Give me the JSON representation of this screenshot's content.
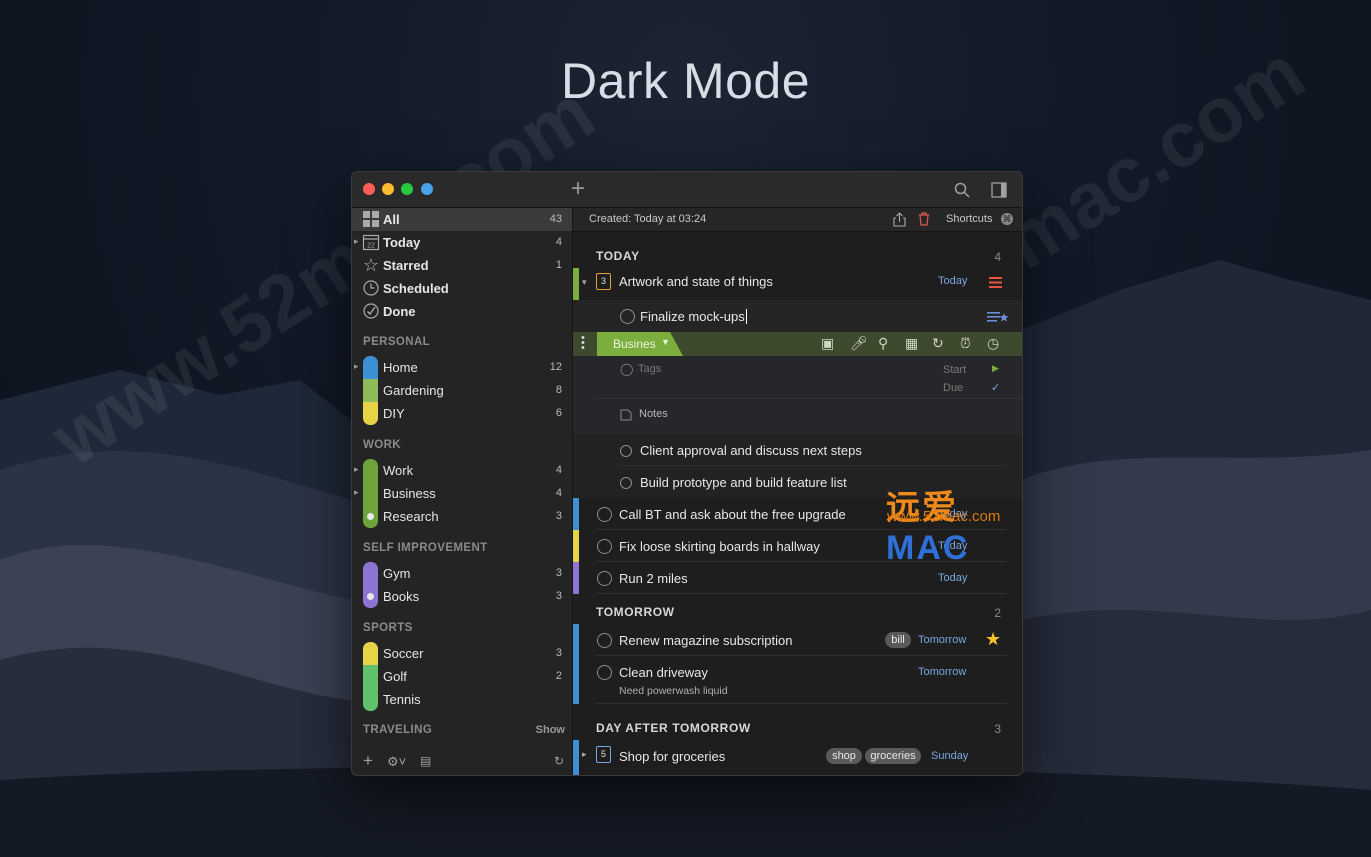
{
  "page": {
    "headline": "Dark Mode"
  },
  "watermarks": [
    "www.52mac.com",
    "www.52mac.com"
  ],
  "overlay_logo": {
    "cn_text": "远爱",
    "mac_text": "MAC",
    "url": "www.52mac.com"
  },
  "colors": {
    "close": "#ff5f57",
    "minimize": "#febc2e",
    "zoom": "#28c840",
    "extra": "#4aa3e8",
    "green_strip": "#7bae3c",
    "blue_strip": "#3f8fd6",
    "yellow_strip": "#e6d348",
    "purple_strip": "#8d74d4"
  },
  "toolbar": {
    "add_icon": "plus-icon",
    "search_icon": "search-icon",
    "sidebar_toggle_icon": "sidebar-toggle-icon"
  },
  "sidebar": {
    "smart_lists": [
      {
        "label": "All",
        "count": "43",
        "icon": "grid-icon"
      },
      {
        "label": "Today",
        "count": "4",
        "icon": "calendar-icon"
      },
      {
        "label": "Starred",
        "count": "1",
        "icon": "star-icon"
      },
      {
        "label": "Scheduled",
        "count": "",
        "icon": "clock-icon"
      },
      {
        "label": "Done",
        "count": "",
        "icon": "check-circle-icon"
      }
    ],
    "personal": {
      "title": "PERSONAL",
      "items": [
        {
          "label": "Home",
          "count": "12",
          "color": "#3f8fd6"
        },
        {
          "label": "Gardening",
          "count": "8",
          "color": "#8fba58"
        },
        {
          "label": "DIY",
          "count": "6",
          "color": "#e6d348"
        }
      ]
    },
    "work": {
      "title": "WORK",
      "items": [
        {
          "label": "Work",
          "count": "4",
          "color": "#6ea23a"
        },
        {
          "label": "Business",
          "count": "4",
          "color": "#6ea23a"
        },
        {
          "label": "Research",
          "count": "3",
          "color": "#6ea23a"
        }
      ]
    },
    "self_improvement": {
      "title": "SELF IMPROVEMENT",
      "items": [
        {
          "label": "Gym",
          "count": "3",
          "color": "#8d74d4"
        },
        {
          "label": "Books",
          "count": "3",
          "color": "#8d74d4"
        }
      ]
    },
    "sports": {
      "title": "SPORTS",
      "items": [
        {
          "label": "Soccer",
          "count": "3",
          "color": "#e6d348"
        },
        {
          "label": "Golf",
          "count": "2",
          "color": "#5fc26a"
        },
        {
          "label": "Tennis",
          "count": "",
          "color": "#5fc26a"
        }
      ]
    },
    "traveling": {
      "title": "TRAVELING",
      "action": "Show"
    }
  },
  "infobar": {
    "created": "Created: Today at 03:24",
    "shortcuts": "Shortcuts"
  },
  "groups": {
    "today": {
      "title": "TODAY",
      "count": "4"
    },
    "tomorrow": {
      "title": "TOMORROW",
      "count": "2"
    },
    "day_after": {
      "title": "DAY AFTER TOMORROW",
      "count": "3"
    }
  },
  "tasks": {
    "artwork": {
      "title": "Artwork and state of things",
      "date": "Today",
      "badge": "3"
    },
    "finalize": {
      "title": "Finalize mock-ups"
    },
    "editor": {
      "list": "Busines",
      "tags": "Tags",
      "start": "Start",
      "due": "Due",
      "notes": "Notes"
    },
    "client": {
      "title": "Client approval and discuss next steps"
    },
    "build": {
      "title": "Build prototype and build feature list"
    },
    "call": {
      "title": "Call BT and ask about the free upgrade",
      "date": "Today"
    },
    "fix": {
      "title": "Fix loose skirting boards in hallway",
      "date": "Today"
    },
    "run": {
      "title": "Run 2 miles",
      "date": "Today"
    },
    "renew": {
      "title": "Renew magazine subscription",
      "tag": "bill",
      "date": "Tomorrow"
    },
    "clean": {
      "title": "Clean driveway",
      "note": "Need powerwash liquid",
      "date": "Tomorrow"
    },
    "shop": {
      "title": "Shop for groceries",
      "badge": "5",
      "tags": [
        "shop",
        "groceries"
      ],
      "date": "Sunday"
    }
  }
}
